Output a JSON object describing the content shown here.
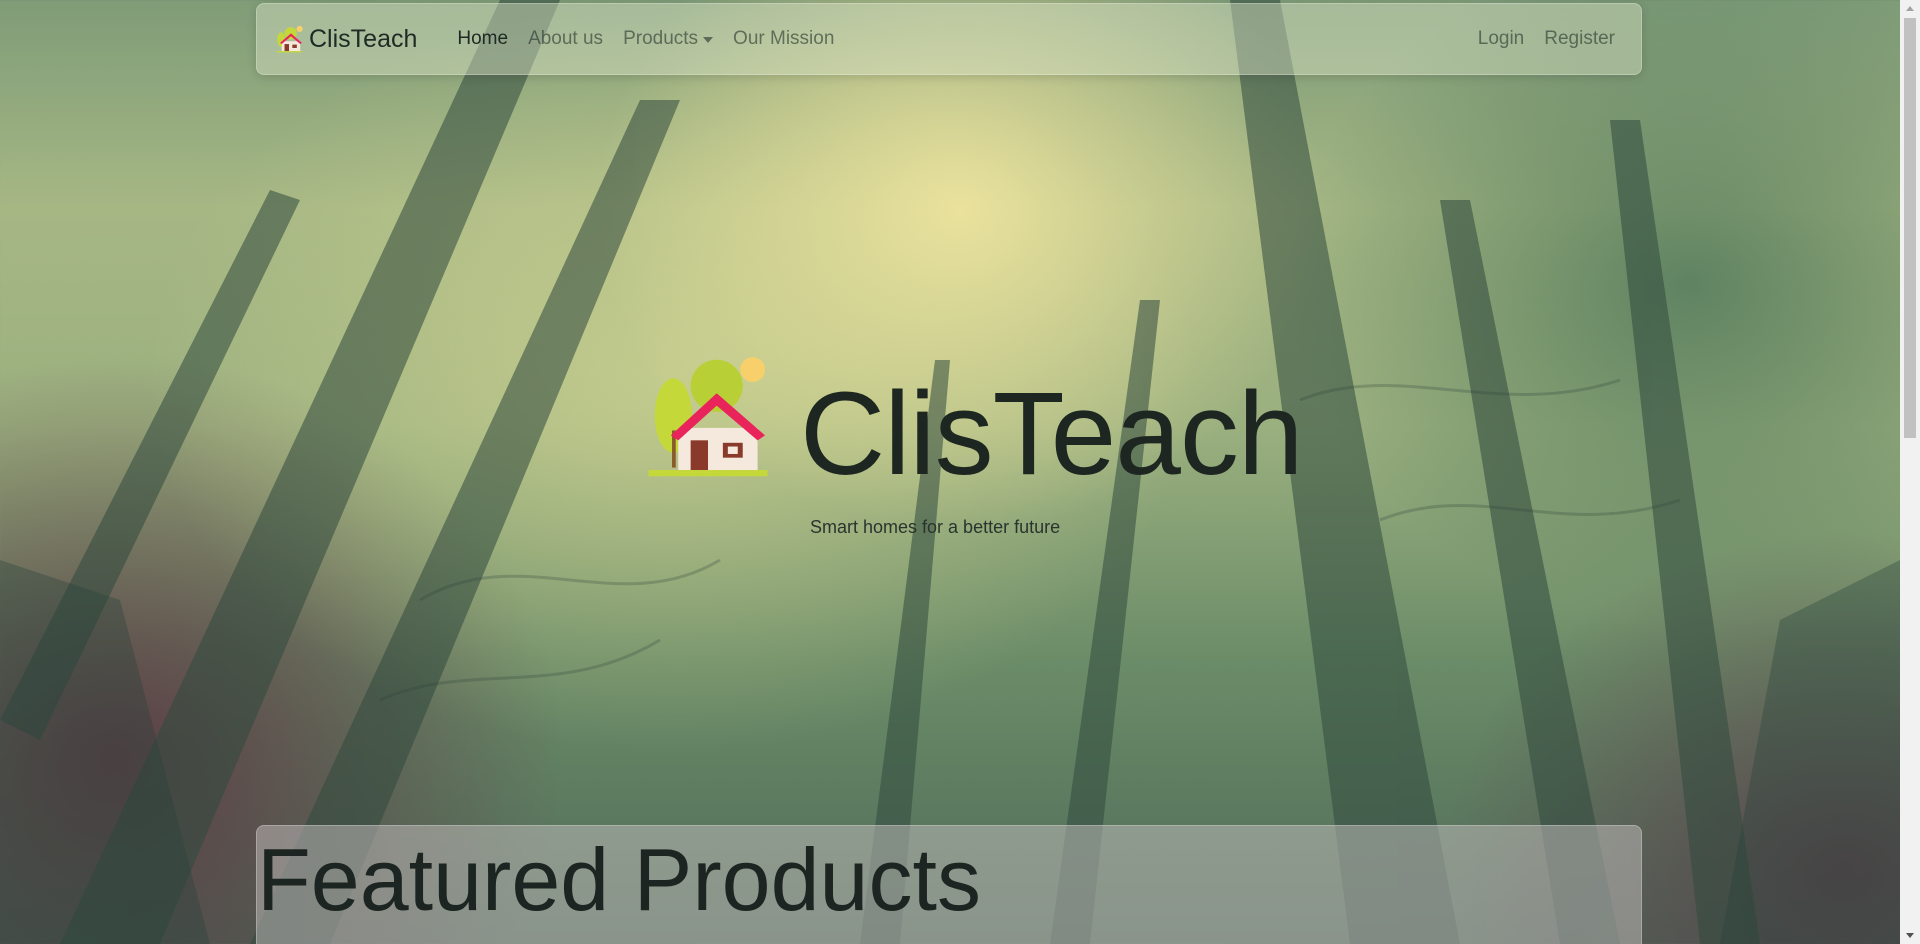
{
  "navbar": {
    "brand": "ClisTeach",
    "links": [
      {
        "label": "Home"
      },
      {
        "label": "About us"
      },
      {
        "label": "Products"
      },
      {
        "label": "Our Mission"
      }
    ],
    "right_links": [
      {
        "label": "Login"
      },
      {
        "label": "Register"
      }
    ]
  },
  "hero": {
    "title": "ClisTeach",
    "subtitle": "Smart homes for a better future"
  },
  "featured": {
    "title": "Featured Products"
  },
  "colors": {
    "navbar_bg": "#d6e0c4",
    "text_dark": "#1d2620",
    "house_roof": "#e8245a",
    "house_wall": "#f4e9dc",
    "tree_green": "#c5d83a",
    "sun": "#f7d06b"
  }
}
